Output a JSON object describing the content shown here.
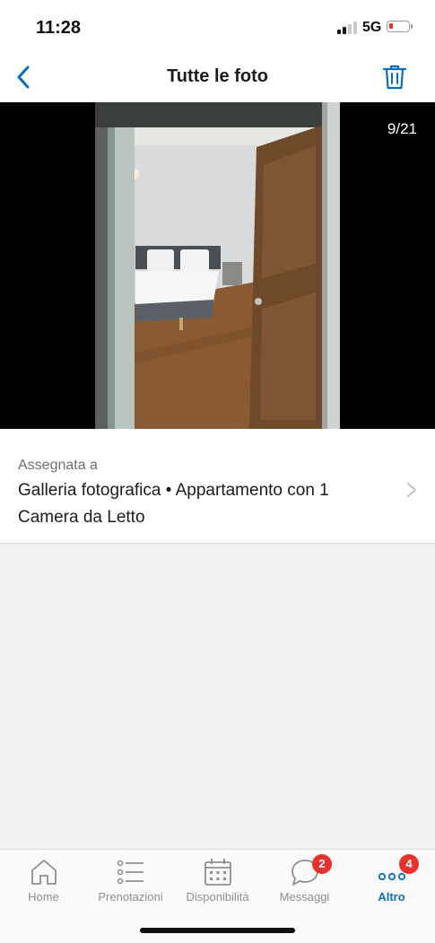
{
  "status_bar": {
    "time": "11:28",
    "network": "5G"
  },
  "nav": {
    "title": "Tutte le foto"
  },
  "photo": {
    "counter": "9/21"
  },
  "assignment": {
    "label": "Assegnata a",
    "value": "Galleria fotografica • Appartamento con 1 Camera da Letto"
  },
  "tabs": [
    {
      "label": "Home",
      "icon": "home-icon"
    },
    {
      "label": "Prenotazioni",
      "icon": "list-icon"
    },
    {
      "label": "Disponibilità",
      "icon": "calendar-icon"
    },
    {
      "label": "Messaggi",
      "icon": "chat-icon",
      "badge": "2"
    },
    {
      "label": "Altro",
      "icon": "more-icon",
      "badge": "4",
      "active": true
    }
  ],
  "colors": {
    "accent": "#0a6ebd",
    "badge": "#e5322d",
    "inactive": "#8e8e93"
  }
}
